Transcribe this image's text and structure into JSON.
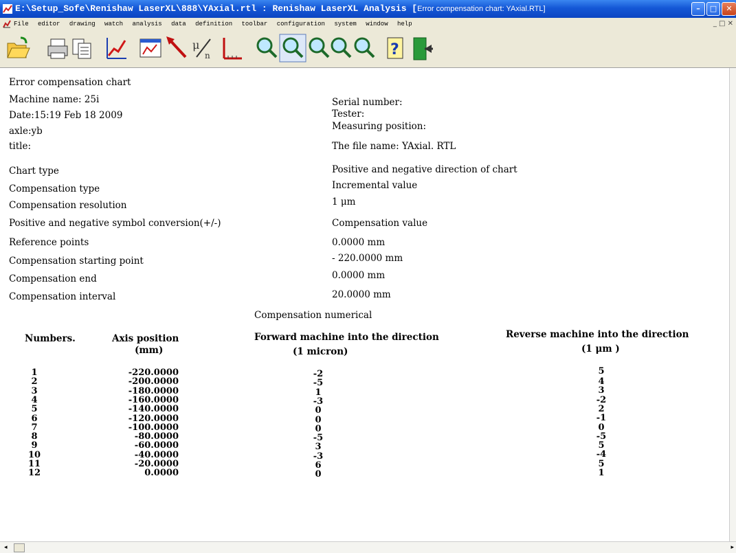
{
  "window": {
    "title": "E:\\Setup_Sofe\\Renishaw LaserXL\\888\\YAxial.rtl : Renishaw LaserXL Analysis [",
    "title_suffix": "Error compensation chart: YAxial.RTL]",
    "min_glyph": "–",
    "max_glyph": "□",
    "close_glyph": "✕"
  },
  "menu": {
    "items": [
      "File",
      "editor",
      "drawing",
      "watch",
      "analysis",
      "data",
      "definition",
      "toolbar",
      "configuration",
      "system",
      "window",
      "help"
    ],
    "mdi_controls": "_ □ ✕"
  },
  "toolbar": {
    "icons": [
      "open-folder-icon",
      "print-icon",
      "copy-icon",
      "line-chart-icon",
      "window-chart-icon",
      "cursor-arrow-icon",
      "mu-symbol-icon",
      "axis-ruler-icon",
      "zoom-x1-icon",
      "zoom-x2-icon",
      "zoom-x4-icon",
      "zoom-icon",
      "zoom-x8-icon",
      "help-icon",
      "exit-door-icon"
    ]
  },
  "report": {
    "heading": "Error compensation chart",
    "machine_name": "Machine name: 25i",
    "date": "Date:15:19 Feb 18 2009",
    "axle": "axle:yb",
    "title": "title:",
    "serial_number": "Serial number:",
    "tester": "Tester:",
    "measuring_position": "Measuring position:",
    "file_name": "The file name: YAxial. RTL",
    "settings": [
      {
        "label": "Chart type",
        "value": "Positive and negative direction of chart"
      },
      {
        "label": "Compensation type",
        "value": "Incremental value"
      },
      {
        "label": "Compensation resolution",
        "value": "1 μm"
      },
      {
        "label": "Positive and negative symbol conversion(+/-)",
        "value": "Compensation value"
      },
      {
        "label": "Reference points",
        "value": "0.0000 mm"
      },
      {
        "label": "Compensation starting point",
        "value": "- 220.0000 mm"
      },
      {
        "label": "Compensation end",
        "value": "0.0000 mm"
      },
      {
        "label": "Compensation interval",
        "value": "20.0000 mm"
      }
    ],
    "table_title": "Compensation numerical",
    "table": {
      "col_numbers": "Numbers.",
      "col_axis": "Axis position",
      "col_axis_unit": "(mm)",
      "col_forward": "Forward machine into the direction",
      "col_forward_unit": "(1  micron)",
      "col_reverse": "Reverse machine into the direction",
      "col_reverse_unit": "(1  μm )",
      "rows": [
        {
          "n": "1",
          "pos": "-220.0000",
          "fwd": "-2",
          "rev": "4"
        },
        {
          "n": "2",
          "pos": "-200.0000",
          "fwd": "-5",
          "rev": "3"
        },
        {
          "n": "3",
          "pos": "-180.0000",
          "fwd": "1",
          "rev": "-2"
        },
        {
          "n": "4",
          "pos": "-160.0000",
          "fwd": "-3",
          "rev": "2"
        },
        {
          "n": "5",
          "pos": "-140.0000",
          "fwd": "0",
          "rev": "-1"
        },
        {
          "n": "6",
          "pos": "-120.0000",
          "fwd": "0",
          "rev": "0"
        },
        {
          "n": "7",
          "pos": "-100.0000",
          "fwd": "0",
          "rev": "-5"
        },
        {
          "n": "8",
          "pos": "-80.0000",
          "fwd": "-5",
          "rev": "5"
        },
        {
          "n": "9",
          "pos": "-60.0000",
          "fwd": "3",
          "rev": "-4"
        },
        {
          "n": "10",
          "pos": "-40.0000",
          "fwd": "-3",
          "rev": "5"
        },
        {
          "n": "11",
          "pos": "-20.0000",
          "fwd": "6",
          "rev": "1"
        },
        {
          "n": "12",
          "pos": "0.0000",
          "fwd": "0",
          "rev": ""
        }
      ],
      "reverse_leading": "5"
    }
  },
  "scrollbar": {
    "left_arrow": "◂",
    "right_arrow": "▸"
  }
}
